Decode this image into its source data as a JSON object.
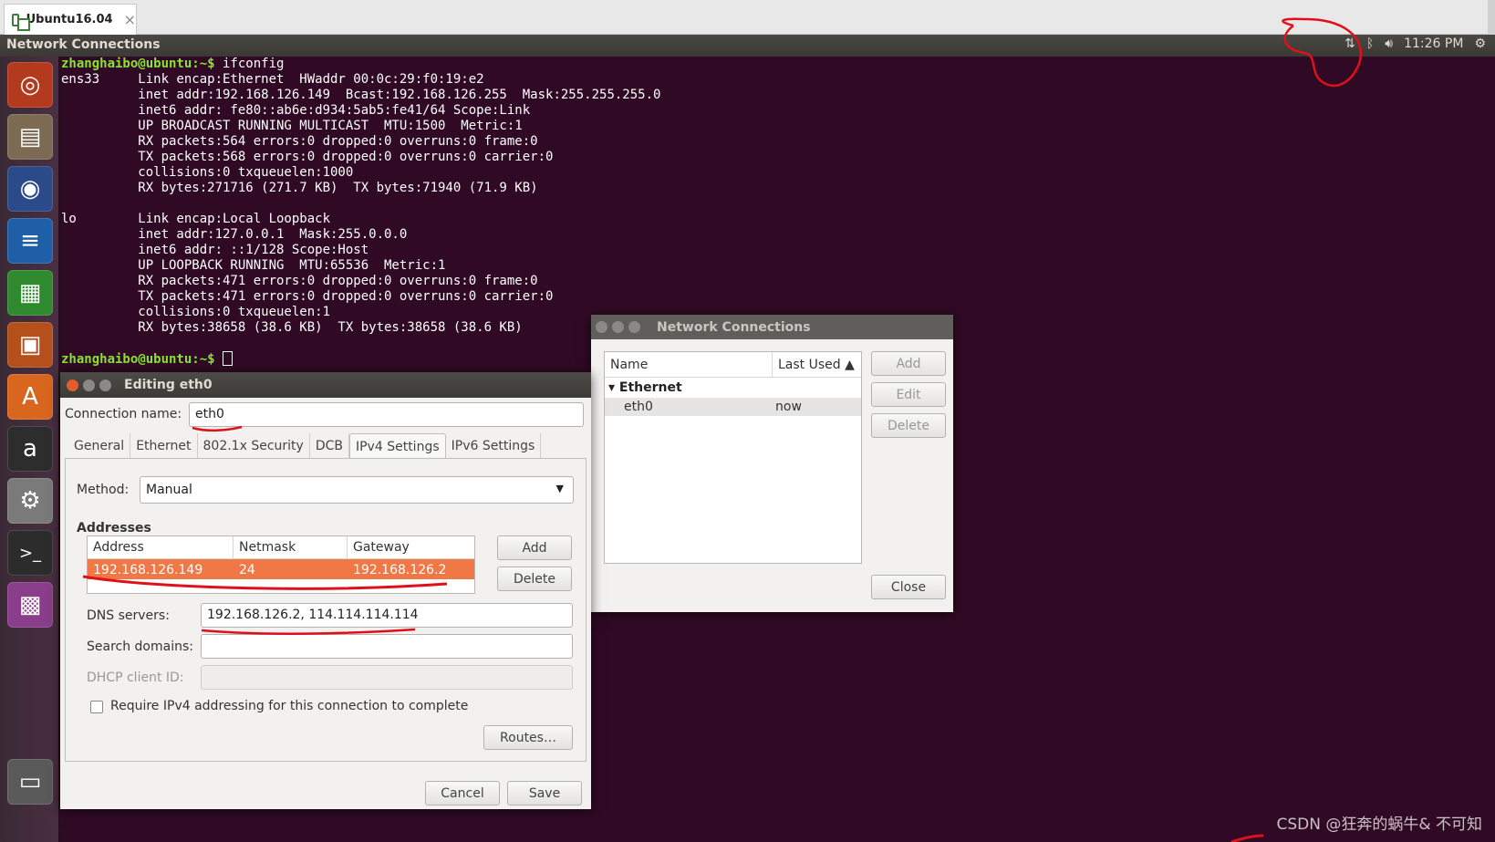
{
  "vm_tab": {
    "label": "Ubuntu16.04"
  },
  "top_panel": {
    "title": "Network Connections",
    "time": "11:26 PM"
  },
  "launcher": [
    {
      "name": "ubuntu-dash-icon",
      "glyph": "◎",
      "bg": "#b33a1c"
    },
    {
      "name": "files-icon",
      "glyph": "▤",
      "bg": "#7c6a52"
    },
    {
      "name": "firefox-icon",
      "glyph": "◉",
      "bg": "#2b4a8a"
    },
    {
      "name": "writer-icon",
      "glyph": "≡",
      "bg": "#1f5fa8"
    },
    {
      "name": "calc-icon",
      "glyph": "▦",
      "bg": "#2f8a2f"
    },
    {
      "name": "impress-icon",
      "glyph": "▣",
      "bg": "#b5501d"
    },
    {
      "name": "software-center-icon",
      "glyph": "A",
      "bg": "#d9661e"
    },
    {
      "name": "amazon-icon",
      "glyph": "a",
      "bg": "#2d2d2d"
    },
    {
      "name": "system-settings-icon",
      "glyph": "⚙",
      "bg": "#7a7a7a"
    },
    {
      "name": "terminal-icon",
      "glyph": ">_",
      "bg": "#2c2c2c"
    },
    {
      "name": "network-connections-icon",
      "glyph": "▩",
      "bg": "#8a3d8a"
    },
    {
      "name": "trash-icon",
      "glyph": "▭",
      "bg": "#5a5a5a"
    }
  ],
  "terminal": {
    "prompt": "zhanghaibo@ubuntu:~$",
    "command": " ifconfig",
    "lines": [
      "ens33     Link encap:Ethernet  HWaddr 00:0c:29:f0:19:e2  ",
      "          inet addr:192.168.126.149  Bcast:192.168.126.255  Mask:255.255.255.0",
      "          inet6 addr: fe80::ab6e:d934:5ab5:fe41/64 Scope:Link",
      "          UP BROADCAST RUNNING MULTICAST  MTU:1500  Metric:1",
      "          RX packets:564 errors:0 dropped:0 overruns:0 frame:0",
      "          TX packets:568 errors:0 dropped:0 overruns:0 carrier:0",
      "          collisions:0 txqueuelen:1000 ",
      "          RX bytes:271716 (271.7 KB)  TX bytes:71940 (71.9 KB)",
      "",
      "lo        Link encap:Local Loopback  ",
      "          inet addr:127.0.0.1  Mask:255.0.0.0",
      "          inet6 addr: ::1/128 Scope:Host",
      "          UP LOOPBACK RUNNING  MTU:65536  Metric:1",
      "          RX packets:471 errors:0 dropped:0 overruns:0 frame:0",
      "          TX packets:471 errors:0 dropped:0 overruns:0 carrier:0",
      "          collisions:0 txqueuelen:1 ",
      "          RX bytes:38658 (38.6 KB)  TX bytes:38658 (38.6 KB)",
      ""
    ]
  },
  "network_connections": {
    "title": "Network Connections",
    "col_name": "Name",
    "col_last_used": "Last Used",
    "group": "Ethernet",
    "row_name": "eth0",
    "row_last_used": "now",
    "add": "Add",
    "edit": "Edit",
    "delete": "Delete",
    "close": "Close"
  },
  "editing": {
    "title": "Editing eth0",
    "conn_name_label": "Connection name:",
    "conn_name_value": "eth0",
    "tabs": [
      "General",
      "Ethernet",
      "802.1x Security",
      "DCB",
      "IPv4 Settings",
      "IPv6 Settings"
    ],
    "method_label": "Method:",
    "method_value": "Manual",
    "addresses_label": "Addresses",
    "col_address": "Address",
    "col_netmask": "Netmask",
    "col_gateway": "Gateway",
    "address": "192.168.126.149",
    "netmask": "24",
    "gateway": "192.168.126.2",
    "add": "Add",
    "delete": "Delete",
    "dns_label": "DNS servers:",
    "dns_value": "192.168.126.2, 114.114.114.114",
    "search_label": "Search domains:",
    "dhcp_label": "DHCP client ID:",
    "require_label": "Require IPv4 addressing for this connection to complete",
    "routes": "Routes…",
    "cancel": "Cancel",
    "save": "Save"
  },
  "watermark": "CSDN @狂奔的蜗牛& 不可知",
  "colors": {
    "selection": "#f07746",
    "annotation": "#e0101a",
    "terminal_bg": "#300a24",
    "prompt": "#8ae234"
  }
}
